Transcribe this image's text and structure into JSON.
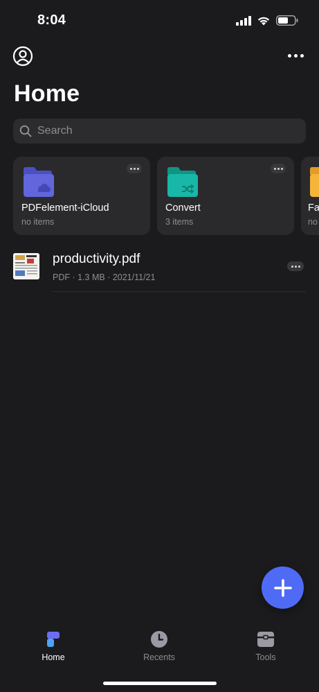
{
  "status_bar": {
    "time": "8:04",
    "icons": [
      "cellular-signal-icon",
      "wifi-icon",
      "battery-icon"
    ]
  },
  "top_bar": {
    "profile_icon": "person-circle-icon",
    "more_icon": "ellipsis-icon"
  },
  "header": {
    "title": "Home"
  },
  "search": {
    "placeholder": "Search",
    "value": "",
    "icon": "search-icon"
  },
  "folders": [
    {
      "name": "PDFelement-iCloud",
      "count": "no items",
      "icon": "cloud-folder-icon",
      "color": "#5b5fcf"
    },
    {
      "name": "Convert",
      "count": "3 items",
      "icon": "shuffle-folder-icon",
      "color": "#17b2a4"
    },
    {
      "name": "Fa",
      "count": "no",
      "icon": "folder-icon",
      "color": "#f5b43a"
    }
  ],
  "files": [
    {
      "name": "productivity.pdf",
      "type": "PDF",
      "size": "1.3 MB",
      "date": "2021/11/21",
      "meta": "PDF  ·  1.3 MB  ·  2021/11/21"
    }
  ],
  "fab": {
    "icon": "plus-icon",
    "color": "#4f6bf6"
  },
  "tabs": [
    {
      "label": "Home",
      "icon": "home-tab-icon",
      "active": true
    },
    {
      "label": "Recents",
      "icon": "clock-icon",
      "active": false
    },
    {
      "label": "Tools",
      "icon": "toolbox-icon",
      "active": false
    }
  ],
  "colors": {
    "background": "#1b1b1d",
    "card": "#2a2a2c",
    "accent": "#4f6bf6",
    "secondary_text": "#8e8e93"
  }
}
